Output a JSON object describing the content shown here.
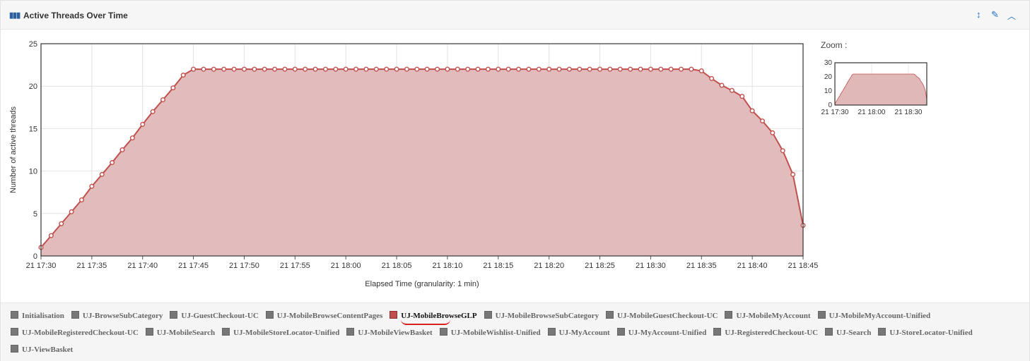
{
  "header": {
    "title": "Active Threads Over Time",
    "tools": [
      "expand-vertical-icon",
      "wrench-icon",
      "collapse-icon"
    ]
  },
  "colors": {
    "series_fill": "#e0b8b8",
    "series_line": "#c0504d",
    "accent": "#1f70c1"
  },
  "chart_data": {
    "type": "area",
    "title": "",
    "xlabel": "Elapsed Time (granularity: 1 min)",
    "ylabel": "Number of active threads",
    "ylim": [
      0,
      25
    ],
    "yticks": [
      0,
      5,
      10,
      15,
      20,
      25
    ],
    "xlim": [
      "21 17:30",
      "21 18:45"
    ],
    "xticks": [
      "21 17:30",
      "21 17:35",
      "21 17:40",
      "21 17:45",
      "21 17:50",
      "21 17:55",
      "21 18:00",
      "21 18:05",
      "21 18:10",
      "21 18:15",
      "21 18:20",
      "21 18:25",
      "21 18:30",
      "21 18:35",
      "21 18:40",
      "21 18:45"
    ],
    "grid": true,
    "x_start": "21 17:30",
    "x_step_min": 1,
    "series": [
      {
        "name": "UJ-MobileBrowseGLP",
        "values": [
          1.0,
          2.4,
          3.8,
          5.2,
          6.6,
          8.2,
          9.6,
          11.0,
          12.5,
          13.9,
          15.5,
          17.0,
          18.4,
          19.8,
          21.3,
          22,
          22,
          22,
          22,
          22,
          22,
          22,
          22,
          22,
          22,
          22,
          22,
          22,
          22,
          22,
          22,
          22,
          22,
          22,
          22,
          22,
          22,
          22,
          22,
          22,
          22,
          22,
          22,
          22,
          22,
          22,
          22,
          22,
          22,
          22,
          22,
          22,
          22,
          22,
          22,
          22,
          22,
          22,
          22,
          22,
          22,
          22,
          22,
          22,
          22,
          21.8,
          20.9,
          20.1,
          19.5,
          18.8,
          17.1,
          15.9,
          14.5,
          12.4,
          9.6,
          3.6
        ]
      }
    ],
    "zoom": {
      "label": "Zoom :",
      "yticks": [
        0,
        10,
        20,
        30
      ],
      "xticks": [
        "21 17:30",
        "21 18:00",
        "21 18:30"
      ]
    }
  },
  "legend": {
    "items": [
      {
        "label": "Initialisation",
        "active": false
      },
      {
        "label": "UJ-BrowseSubCategory",
        "active": false
      },
      {
        "label": "UJ-GuestCheckout-UC",
        "active": false
      },
      {
        "label": "UJ-MobileBrowseContentPages",
        "active": false
      },
      {
        "label": "UJ-MobileBrowseGLP",
        "active": true
      },
      {
        "label": "UJ-MobileBrowseSubCategory",
        "active": false
      },
      {
        "label": "UJ-MobileGuestCheckout-UC",
        "active": false
      },
      {
        "label": "UJ-MobileMyAccount",
        "active": false
      },
      {
        "label": "UJ-MobileMyAccount-Unified",
        "active": false
      },
      {
        "label": "UJ-MobileRegisteredCheckout-UC",
        "active": false
      },
      {
        "label": "UJ-MobileSearch",
        "active": false
      },
      {
        "label": "UJ-MobileStoreLocator-Unified",
        "active": false
      },
      {
        "label": "UJ-MobileViewBasket",
        "active": false
      },
      {
        "label": "UJ-MobileWishlist-Unified",
        "active": false
      },
      {
        "label": "UJ-MyAccount",
        "active": false
      },
      {
        "label": "UJ-MyAccount-Unified",
        "active": false
      },
      {
        "label": "UJ-RegisteredCheckout-UC",
        "active": false
      },
      {
        "label": "UJ-Search",
        "active": false
      },
      {
        "label": "UJ-StoreLocator-Unified",
        "active": false
      },
      {
        "label": "UJ-ViewBasket",
        "active": false
      }
    ]
  }
}
